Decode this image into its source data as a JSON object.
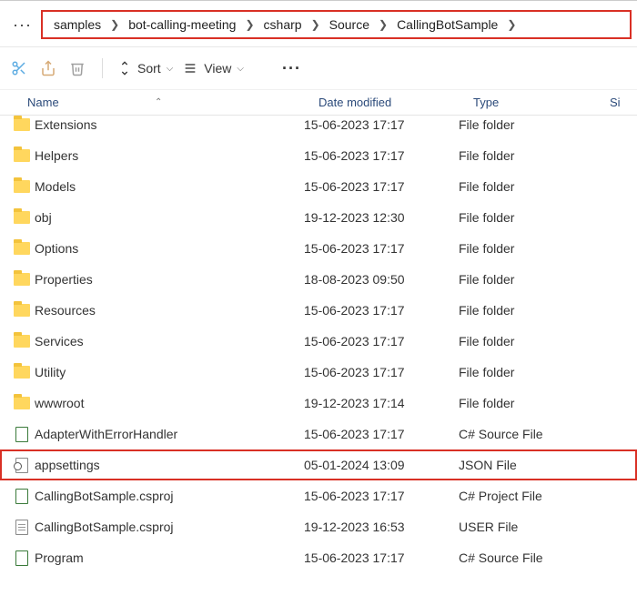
{
  "breadcrumb": {
    "items": [
      "samples",
      "bot-calling-meeting",
      "csharp",
      "Source",
      "CallingBotSample"
    ]
  },
  "toolbar": {
    "sort_label": "Sort",
    "view_label": "View"
  },
  "columns": {
    "name": "Name",
    "date": "Date modified",
    "type": "Type",
    "size": "Si"
  },
  "files": [
    {
      "icon": "folder",
      "name": "Extensions",
      "date": "15-06-2023 17:17",
      "type": "File folder",
      "highlighted": false,
      "cutoff": true
    },
    {
      "icon": "folder",
      "name": "Helpers",
      "date": "15-06-2023 17:17",
      "type": "File folder",
      "highlighted": false
    },
    {
      "icon": "folder",
      "name": "Models",
      "date": "15-06-2023 17:17",
      "type": "File folder",
      "highlighted": false
    },
    {
      "icon": "folder",
      "name": "obj",
      "date": "19-12-2023 12:30",
      "type": "File folder",
      "highlighted": false
    },
    {
      "icon": "folder",
      "name": "Options",
      "date": "15-06-2023 17:17",
      "type": "File folder",
      "highlighted": false
    },
    {
      "icon": "folder",
      "name": "Properties",
      "date": "18-08-2023 09:50",
      "type": "File folder",
      "highlighted": false
    },
    {
      "icon": "folder",
      "name": "Resources",
      "date": "15-06-2023 17:17",
      "type": "File folder",
      "highlighted": false
    },
    {
      "icon": "folder",
      "name": "Services",
      "date": "15-06-2023 17:17",
      "type": "File folder",
      "highlighted": false
    },
    {
      "icon": "folder",
      "name": "Utility",
      "date": "15-06-2023 17:17",
      "type": "File folder",
      "highlighted": false
    },
    {
      "icon": "folder",
      "name": "wwwroot",
      "date": "19-12-2023 17:14",
      "type": "File folder",
      "highlighted": false
    },
    {
      "icon": "csdoc",
      "name": "AdapterWithErrorHandler",
      "date": "15-06-2023 17:17",
      "type": "C# Source File",
      "highlighted": false
    },
    {
      "icon": "json",
      "name": "appsettings",
      "date": "05-01-2024 13:09",
      "type": "JSON File",
      "highlighted": true
    },
    {
      "icon": "csproj",
      "name": "CallingBotSample.csproj",
      "date": "15-06-2023 17:17",
      "type": "C# Project File",
      "highlighted": false
    },
    {
      "icon": "doc",
      "name": "CallingBotSample.csproj",
      "date": "19-12-2023 16:53",
      "type": "USER File",
      "highlighted": false
    },
    {
      "icon": "csdoc",
      "name": "Program",
      "date": "15-06-2023 17:17",
      "type": "C# Source File",
      "highlighted": false
    }
  ]
}
